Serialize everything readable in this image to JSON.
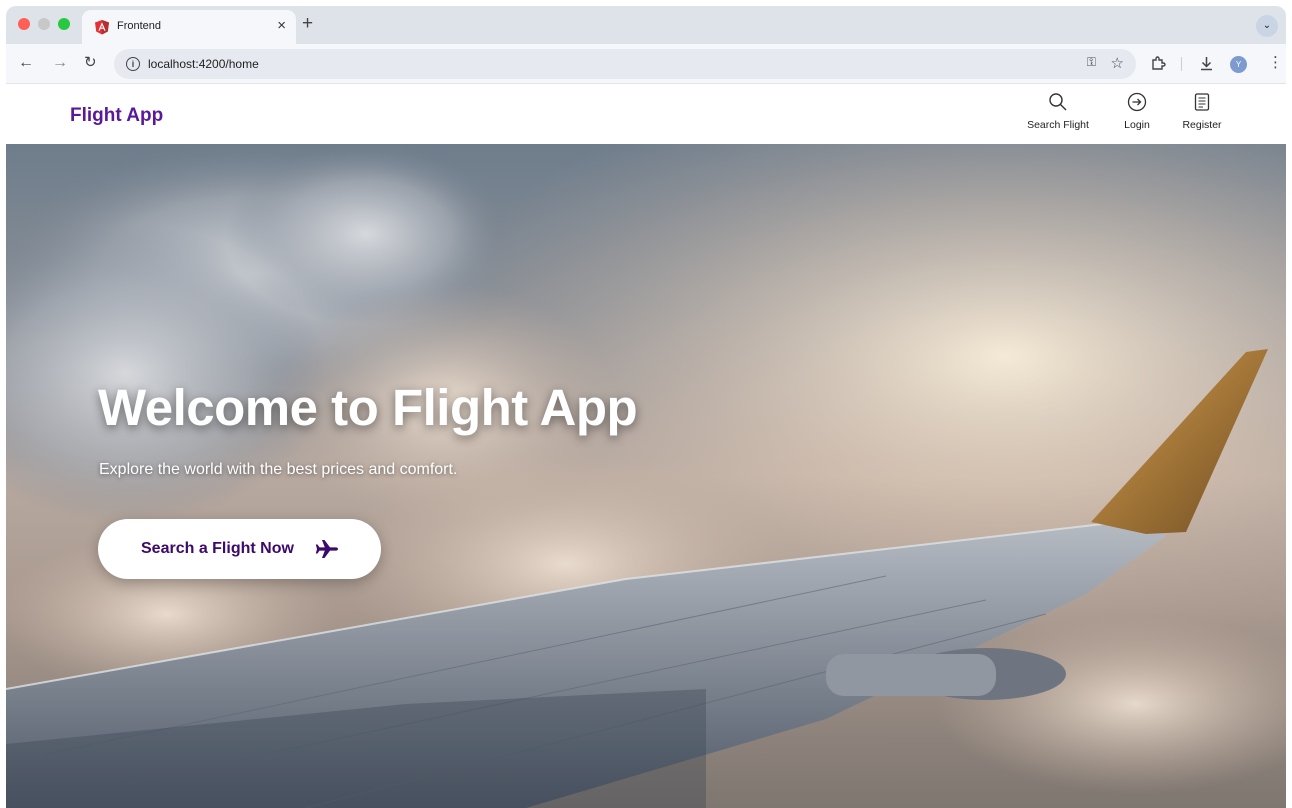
{
  "browser": {
    "tab_title": "Frontend",
    "tab_close": "×",
    "new_tab": "+",
    "url": "localhost:4200/home",
    "profile_initial": "Y"
  },
  "app": {
    "brand": "Flight App",
    "nav": [
      {
        "label": "Search Flight",
        "icon": "search-icon"
      },
      {
        "label": "Login",
        "icon": "login-icon"
      },
      {
        "label": "Register",
        "icon": "register-icon"
      }
    ]
  },
  "hero": {
    "title": "Welcome to Flight App",
    "subtitle": "Explore the world with the best prices and comfort.",
    "cta_label": "Search a Flight Now",
    "cta_icon": "airplane-icon"
  },
  "colors": {
    "brand": "#5a189a",
    "cta_text": "#3c096c"
  }
}
